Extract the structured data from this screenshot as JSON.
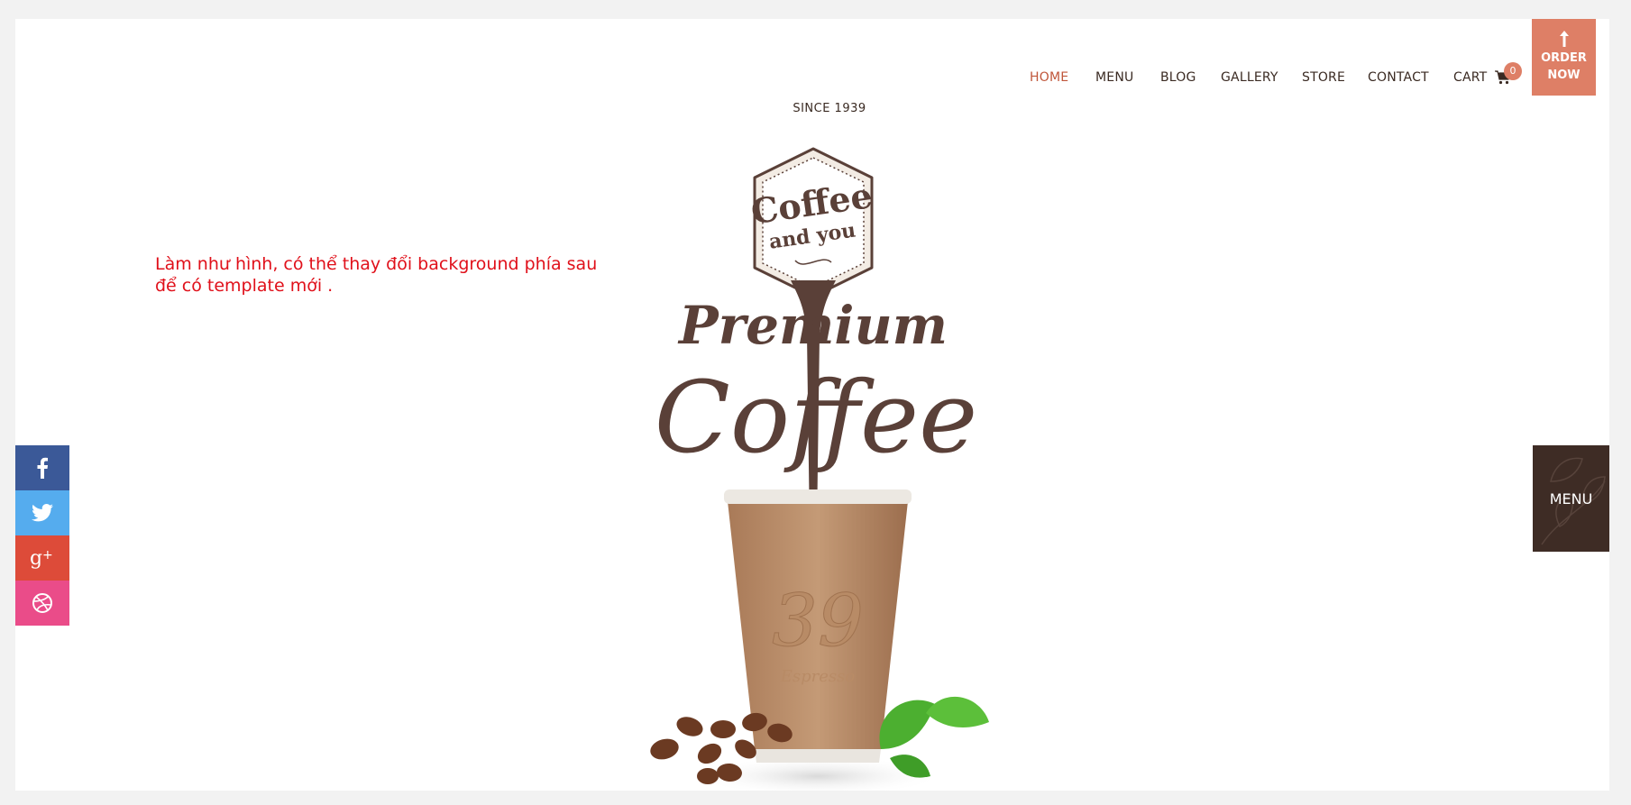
{
  "nav": {
    "items": [
      {
        "label": "HOME",
        "active": true
      },
      {
        "label": "MENU",
        "active": false
      },
      {
        "label": "BLOG",
        "active": false
      },
      {
        "label": "GALLERY",
        "active": false
      },
      {
        "label": "STORE",
        "active": false
      },
      {
        "label": "CONTACT",
        "active": false
      }
    ],
    "cart_label": "CART",
    "cart_count": "0",
    "cart_icon": "shopping-cart-icon",
    "order_label_1": "ORDER",
    "order_label_2": "NOW",
    "order_icon": "arrow-up-icon"
  },
  "hero": {
    "since": "SINCE 1939",
    "badge_line_1": "Coffee",
    "badge_line_2": "and you",
    "premium": "Premium",
    "coffee": "Coffee",
    "cup_number": "39",
    "cup_text": "Espresso"
  },
  "note": "Làm như hình, có thể thay đổi background phía sau để có template mới .",
  "social": [
    {
      "name": "facebook",
      "icon": "facebook-icon",
      "color": "#3b5998"
    },
    {
      "name": "twitter",
      "icon": "twitter-icon",
      "color": "#55acee"
    },
    {
      "name": "google-plus",
      "icon": "google-plus-icon",
      "color": "#dd4b39"
    },
    {
      "name": "dribbble",
      "icon": "dribbble-icon",
      "color": "#ea4c89"
    }
  ],
  "side_menu": {
    "label": "MENU"
  },
  "colors": {
    "accent": "#de7f66",
    "active_nav": "#c0563a",
    "brown": "#5a4038",
    "text": "#3a2a22"
  }
}
